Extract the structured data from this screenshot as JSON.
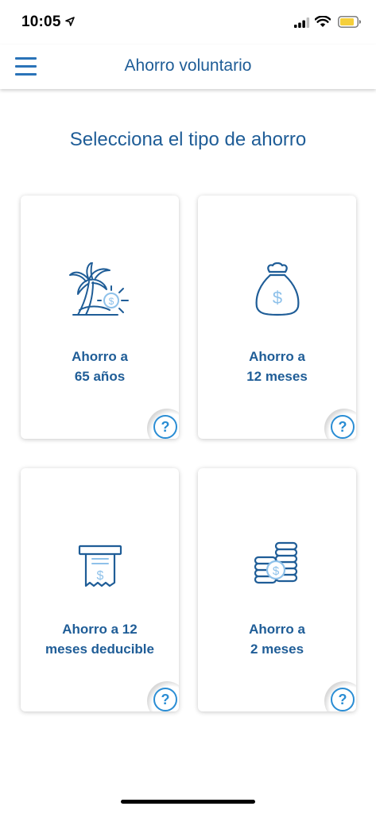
{
  "status_bar": {
    "time": "10:05",
    "icons": [
      "location-arrow-icon",
      "signal-icon",
      "wifi-icon",
      "battery-icon"
    ]
  },
  "header": {
    "title": "Ahorro voluntario",
    "menu_icon": "hamburger-menu-icon"
  },
  "main": {
    "title": "Selecciona el tipo de ahorro",
    "cards": [
      {
        "line1": "Ahorro a",
        "line2": "65 años",
        "icon": "palm-tree-icon",
        "help": "?"
      },
      {
        "line1": "Ahorro a",
        "line2": "12 meses",
        "icon": "money-bag-icon",
        "help": "?"
      },
      {
        "line1": "Ahorro a 12",
        "line2": "meses deducible",
        "icon": "receipt-icon",
        "help": "?"
      },
      {
        "line1": "Ahorro a",
        "line2": "2 meses",
        "icon": "coin-stack-icon",
        "help": "?"
      }
    ]
  },
  "colors": {
    "primary": "#1f5d97",
    "accent": "#2a8dd4",
    "icon_light": "#8ec1ea"
  }
}
